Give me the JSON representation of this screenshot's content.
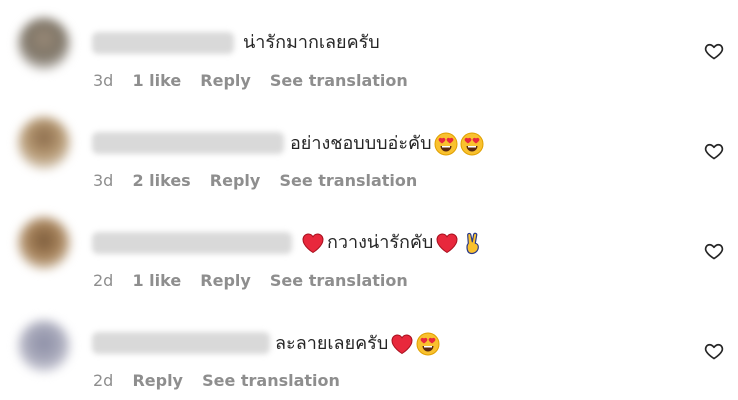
{
  "comments": [
    {
      "text": "น่ารักมากเลยครับ",
      "time": "3d",
      "likes": "1 like",
      "reply": "Reply",
      "translate": "See translation",
      "emojis_after": []
    },
    {
      "text": "อย่างชอบบบอ่ะคับ",
      "time": "3d",
      "likes": "2 likes",
      "reply": "Reply",
      "translate": "See translation",
      "emojis_after": [
        "heart-eyes",
        "heart-eyes"
      ]
    },
    {
      "text": "กวางน่ารักคับ",
      "time": "2d",
      "likes": "1 like",
      "reply": "Reply",
      "translate": "See translation",
      "emojis_before": [
        "red-heart"
      ],
      "emojis_after": [
        "red-heart",
        "victory-hand"
      ]
    },
    {
      "text": "ละลายเลยครับ",
      "time": "2d",
      "likes": "",
      "reply": "Reply",
      "translate": "See translation",
      "emojis_after": [
        "red-heart",
        "heart-eyes"
      ]
    }
  ],
  "colors": {
    "text": "#262626",
    "meta": "#8e8e8e",
    "heart": "#e8283c",
    "emoji_face": "#f9c12e"
  }
}
